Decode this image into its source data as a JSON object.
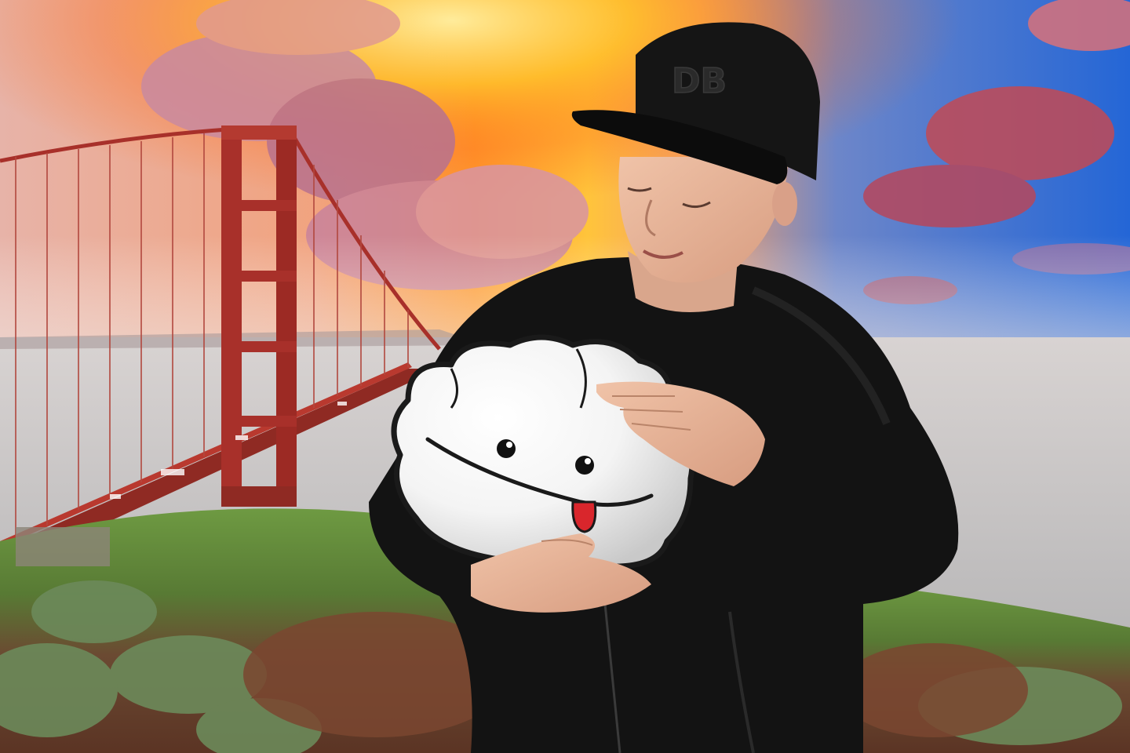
{
  "photo": {
    "cap_logo_letters": "DB",
    "palette": {
      "sky_left": "#e9b9ae",
      "sky_sunburst": "#ffb321",
      "sky_orange": "#ff7a1a",
      "sky_right": "#2c6fd8",
      "cloud_pink": "#c97790",
      "cloud_red": "#c24a4f",
      "bridge_red": "#a8302a",
      "water": "#c9c7c8",
      "hill_green": "#5f8a3a",
      "dirt": "#7a4a35",
      "jacket": "#141414",
      "skin": "#e8b79d",
      "cloud_mascot": "#ffffff",
      "mascot_shadow": "#c8c8c8",
      "mascot_tongue": "#d9262c"
    },
    "icons": {
      "mascot": "cloud-mascot-icon",
      "bridge": "suspension-bridge-icon"
    }
  }
}
